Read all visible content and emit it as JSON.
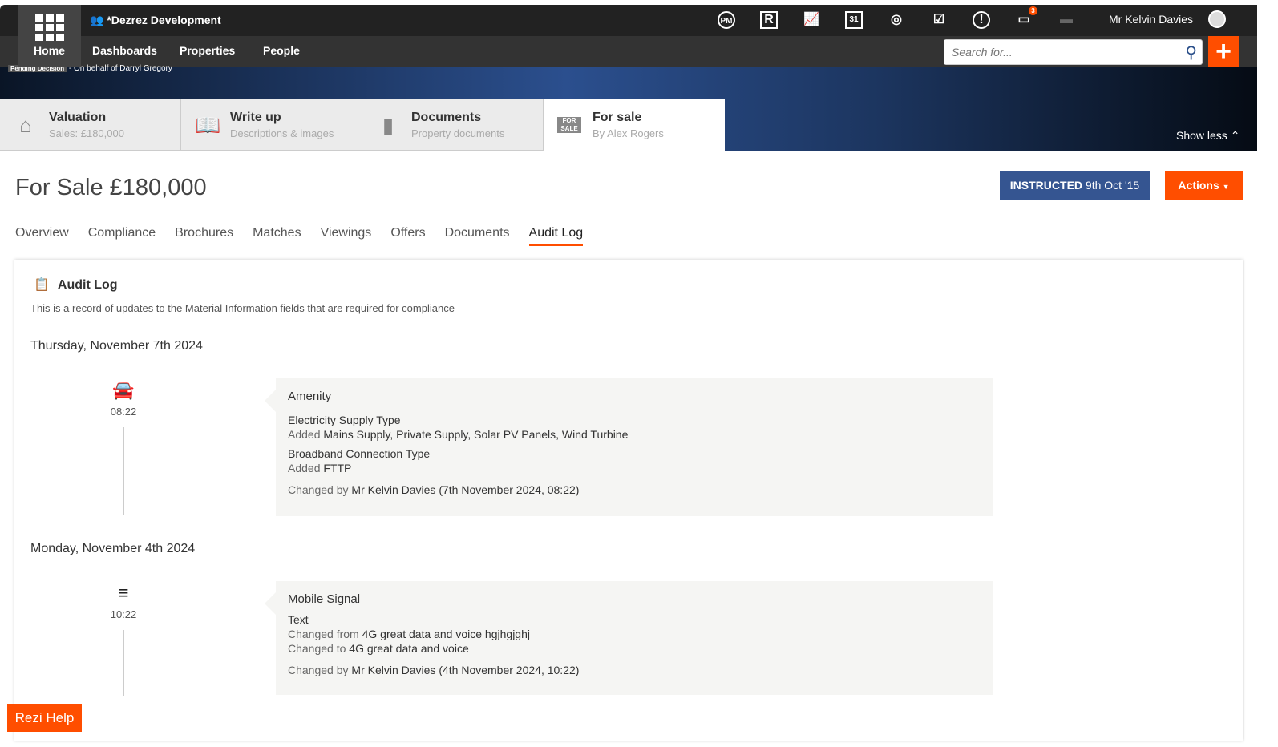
{
  "topbar": {
    "brand": "*Dezrez Development",
    "home": "Home",
    "nav": [
      "Dashboards",
      "Properties",
      "People"
    ],
    "icons": [
      "pm-icon",
      "rezi-icon",
      "chart-icon",
      "calendar-icon",
      "target-icon",
      "tasks-icon",
      "alert-icon",
      "chat-icon",
      "printer-icon"
    ],
    "chat_badge": "3",
    "user": "Mr Kelvin Davies",
    "search_placeholder": "Search for...",
    "accent": "#ff4e00"
  },
  "banner": {
    "pending": "Pending Decision",
    "pending_text": "- On behalf of Darryl Gregory",
    "show_less": "Show less"
  },
  "property_tabs": [
    {
      "title": "Valuation",
      "sub": "Sales: £180,000"
    },
    {
      "title": "Write up",
      "sub": "Descriptions & images"
    },
    {
      "title": "Documents",
      "sub": "Property documents"
    },
    {
      "title": "For sale",
      "sub": "By Alex Rogers"
    }
  ],
  "header": {
    "title": "For Sale £180,000",
    "instructed_label": "INSTRUCTED",
    "instructed_date": "9th Oct '15",
    "actions": "Actions"
  },
  "subtabs": [
    "Overview",
    "Compliance",
    "Brochures",
    "Matches",
    "Viewings",
    "Offers",
    "Documents",
    "Audit Log"
  ],
  "audit": {
    "title": "Audit Log",
    "description": "This is a record of updates to the Material Information fields that are required for compliance",
    "days": [
      {
        "date": "Thursday, November 7th 2024",
        "time": "08:22",
        "category": "Amenity",
        "fields": [
          {
            "name": "Electricity Supply Type",
            "lines": [
              {
                "label": "Added",
                "value": "Mains Supply, Private Supply, Solar PV Panels, Wind Turbine"
              }
            ]
          },
          {
            "name": "Broadband Connection Type",
            "lines": [
              {
                "label": "Added",
                "value": "FTTP"
              }
            ]
          }
        ],
        "changed_label": "Changed by",
        "changed_by": "Mr Kelvin Davies (7th November 2024, 08:22)"
      },
      {
        "date": "Monday, November 4th 2024",
        "time": "10:22",
        "category": "Mobile Signal",
        "fields": [
          {
            "name": "Text",
            "lines": [
              {
                "label": "Changed from",
                "value": "4G great data and voice hgjhgjghj"
              },
              {
                "label": "Changed to",
                "value": "4G great data and voice"
              }
            ]
          }
        ],
        "changed_label": "Changed by",
        "changed_by": "Mr Kelvin Davies (4th November 2024, 10:22)"
      }
    ]
  },
  "help": "Rezi Help"
}
